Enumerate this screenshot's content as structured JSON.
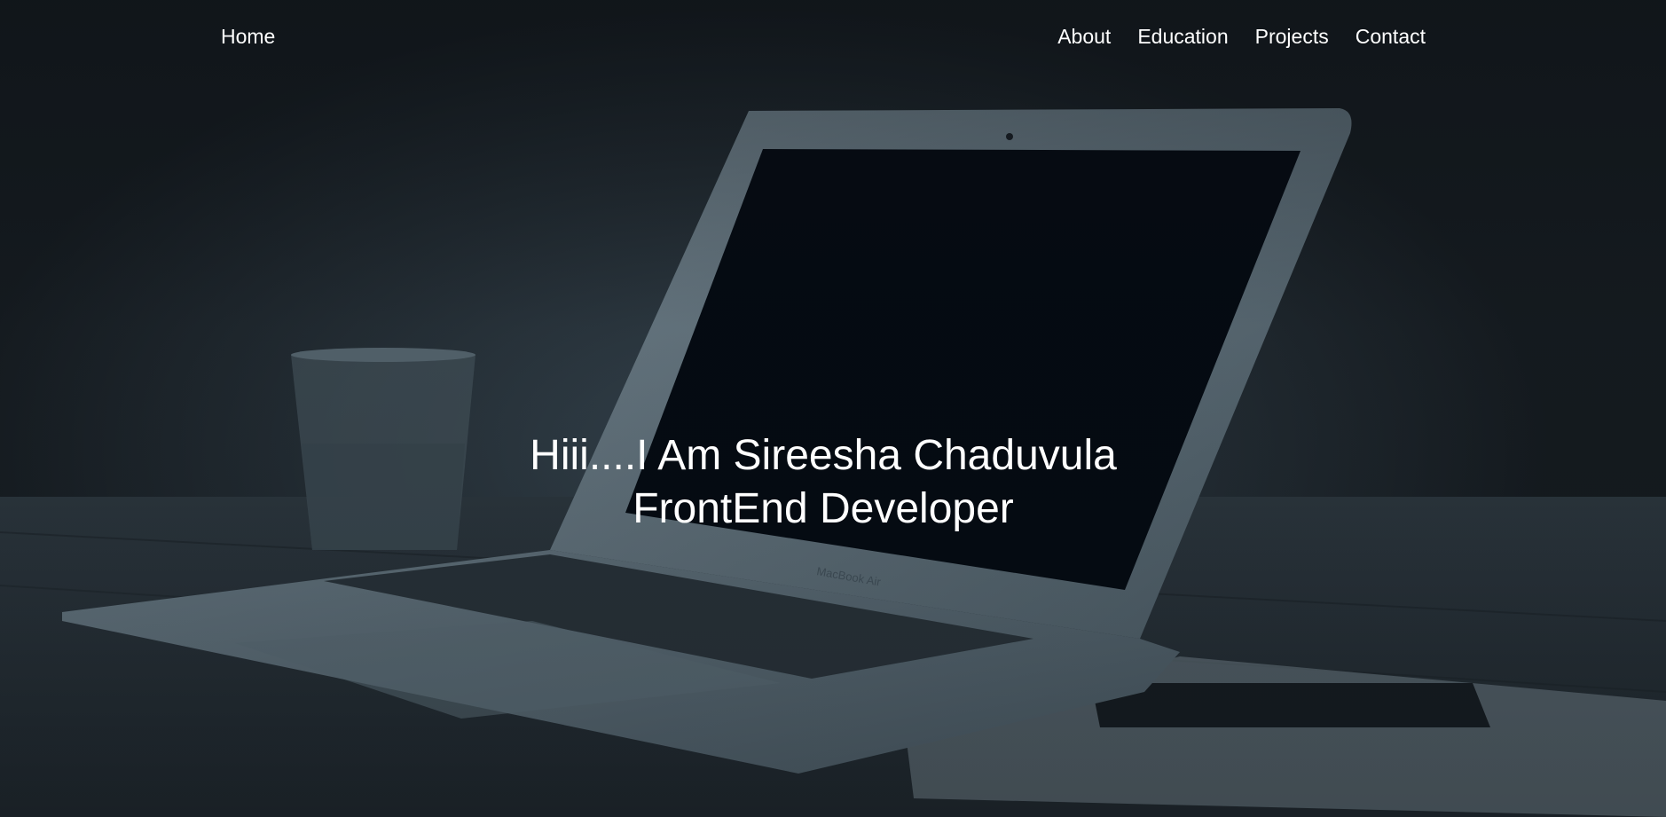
{
  "nav": {
    "home_label": "Home",
    "links": [
      {
        "label": "About"
      },
      {
        "label": "Education"
      },
      {
        "label": "Projects"
      },
      {
        "label": "Contact"
      }
    ]
  },
  "hero": {
    "greeting": "Hiii....I Am Sireesha Chaduvula",
    "role": "FrontEnd Developer",
    "laptop_badge": "MacBook Air"
  },
  "colors": {
    "text": "#ffffff",
    "background_dark": "#161c21",
    "screen": "#040a12"
  }
}
